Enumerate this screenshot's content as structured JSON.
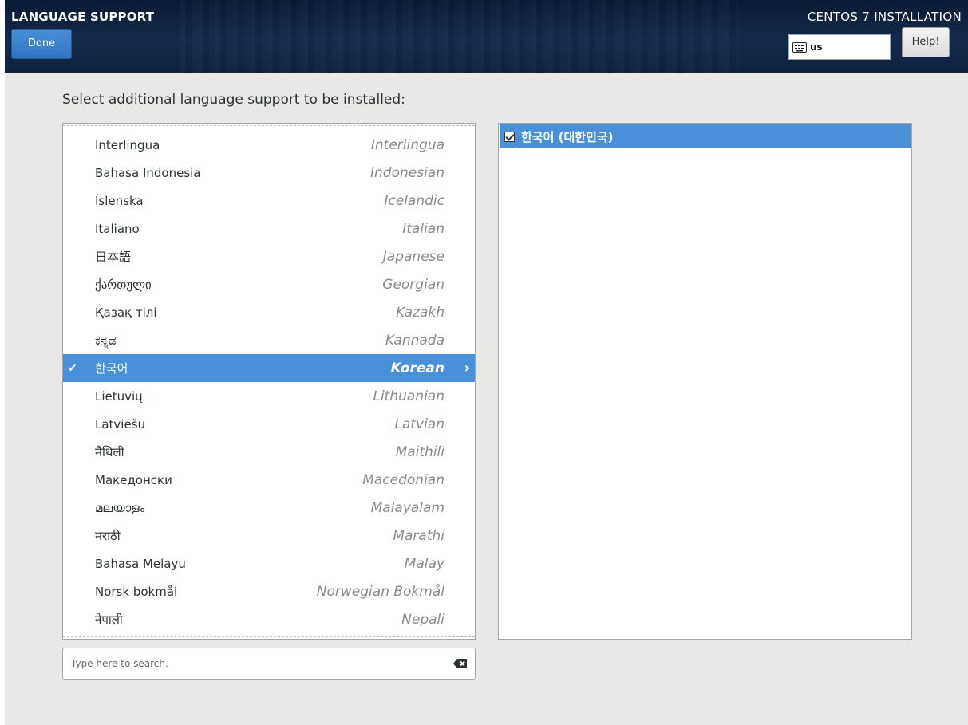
{
  "header": {
    "title": "LANGUAGE SUPPORT",
    "done_label": "Done",
    "product_title": "CENTOS 7 INSTALLATION",
    "keyboard_layout": "us",
    "help_label": "Help!"
  },
  "prompt": "Select additional language support to be installed:",
  "languages": [
    {
      "native": "Interlingua",
      "english": "Interlingua",
      "selected": false
    },
    {
      "native": "Bahasa Indonesia",
      "english": "Indonesian",
      "selected": false
    },
    {
      "native": "Íslenska",
      "english": "Icelandic",
      "selected": false
    },
    {
      "native": "Italiano",
      "english": "Italian",
      "selected": false
    },
    {
      "native": "日本語",
      "english": "Japanese",
      "selected": false
    },
    {
      "native": "ქართული",
      "english": "Georgian",
      "selected": false
    },
    {
      "native": "Қазақ тілі",
      "english": "Kazakh",
      "selected": false
    },
    {
      "native": "ಕನ್ನಡ",
      "english": "Kannada",
      "selected": false
    },
    {
      "native": "한국어",
      "english": "Korean",
      "selected": true
    },
    {
      "native": "Lietuvių",
      "english": "Lithuanian",
      "selected": false
    },
    {
      "native": "Latviešu",
      "english": "Latvian",
      "selected": false
    },
    {
      "native": "मैथिली",
      "english": "Maithili",
      "selected": false
    },
    {
      "native": "Македонски",
      "english": "Macedonian",
      "selected": false
    },
    {
      "native": "മലയാളം",
      "english": "Malayalam",
      "selected": false
    },
    {
      "native": "मराठी",
      "english": "Marathi",
      "selected": false
    },
    {
      "native": "Bahasa Melayu",
      "english": "Malay",
      "selected": false
    },
    {
      "native": "Norsk bokmål",
      "english": "Norwegian Bokmål",
      "selected": false
    },
    {
      "native": "नेपाली",
      "english": "Nepali",
      "selected": false
    }
  ],
  "locales": [
    {
      "label": "한국어 (대한민국)",
      "checked": true
    }
  ],
  "search": {
    "placeholder": "Type here to search.",
    "value": ""
  },
  "colors": {
    "accent": "#4a90d9",
    "header_bg": "#13294c",
    "page_bg": "#e8e8e7"
  },
  "icons": {
    "keyboard": "keyboard-icon",
    "selected_check": "checkmark-icon",
    "row_arrow": "chevron-right-icon",
    "locale_checkbox": "checkbox-checked-icon",
    "search_clear": "backspace-clear-icon"
  }
}
